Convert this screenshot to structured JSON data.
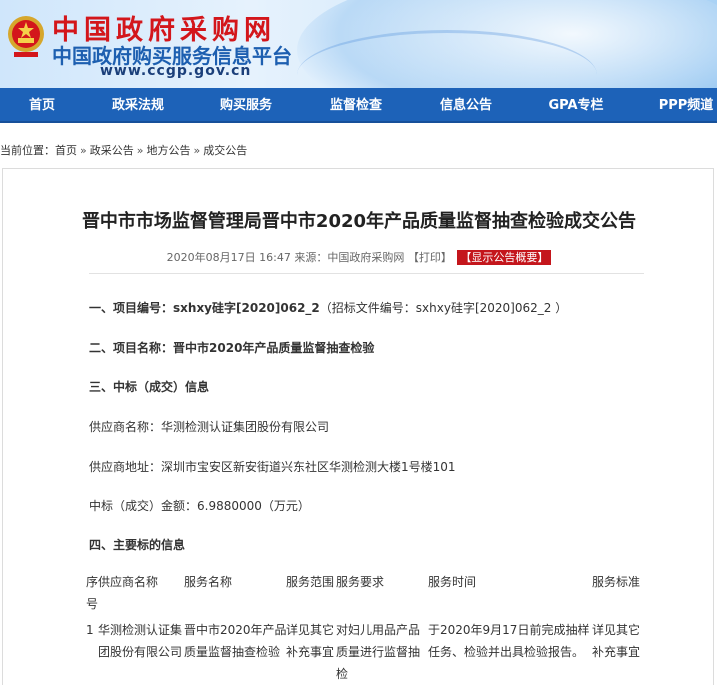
{
  "header": {
    "site_title": "中国政府采购网",
    "site_subtitle": "中国政府购买服务信息平台",
    "site_url": "www.ccgp.gov.cn"
  },
  "nav": {
    "items": [
      {
        "label": "首页"
      },
      {
        "label": "政采法规"
      },
      {
        "label": "购买服务"
      },
      {
        "label": "监督检查"
      },
      {
        "label": "信息公告"
      },
      {
        "label": "GPA专栏"
      },
      {
        "label": "PPP频道"
      }
    ]
  },
  "breadcrumb": {
    "prefix": "当前位置：",
    "items": [
      "首页",
      "政采公告",
      "地方公告",
      "成交公告"
    ],
    "separator": "»"
  },
  "article": {
    "title": "晋中市市场监督管理局晋中市2020年产品质量监督抽查检验成交公告",
    "meta_date": "2020年08月17日 16:47 来源：中国政府采购网",
    "print_label": "【打印】",
    "summary_label": "【显示公告概要】",
    "project_no_label": "一、项目编号：",
    "project_no_value": "sxhxy硅字[2020]062_2",
    "project_no_extra": "（招标文件编号：sxhxy硅字[2020]062_2 ）",
    "project_name_label": "二、项目名称：",
    "project_name_value": "晋中市2020年产品质量监督抽查检验",
    "section3": "三、中标（成交）信息",
    "supplier_name": "供应商名称：华测检测认证集团股份有限公司",
    "supplier_address": "供应商地址：深圳市宝安区新安街道兴东社区华测检测大楼1号楼101",
    "bid_amount": "中标（成交）金额：6.9880000（万元）",
    "section4": "四、主要标的信息"
  },
  "table": {
    "headers": {
      "no_line1": "序",
      "no_line2": "号",
      "supplier": "供应商名称",
      "service": "服务名称",
      "scope": "服务范围",
      "requirement": "服务要求",
      "time": "服务时间",
      "standard": "服务标准"
    },
    "row": {
      "no": "1",
      "supplier_l1": "华测检测认证集",
      "supplier_l2": "团股份有限公司",
      "service_l1": "晋中市2020年产品",
      "service_l2": "质量监督抽查检验",
      "scope_l1": "详见其它",
      "scope_l2": "补充事宜",
      "req_l1": "对妇儿用品产品",
      "req_l2": "质量进行监督抽",
      "req_l3": "检",
      "time_l1": "于2020年9月17日前完成抽样",
      "time_l2": "任务、检验并出具检验报告。",
      "std_l1": "详见其它",
      "std_l2": "补充事宜"
    }
  },
  "colors": {
    "nav_bg": "#1d62b8",
    "title_red": "#d3161b",
    "subtitle_blue": "#1d5fb0",
    "summary_bg": "#c4161c"
  },
  "icons": {
    "emblem": "national-emblem-icon"
  }
}
